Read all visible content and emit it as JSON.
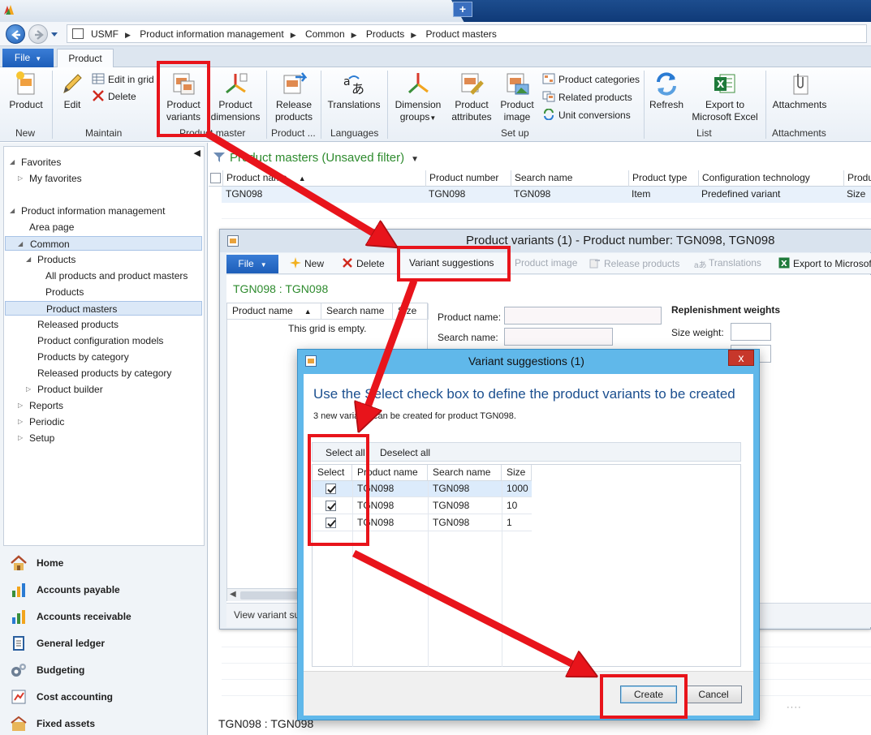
{
  "breadcrumb": [
    "USMF",
    "Product information management",
    "Common",
    "Products",
    "Product masters"
  ],
  "ribbon": {
    "file_tab": "File",
    "active_tab": "Product",
    "groups": {
      "new": "New",
      "maintain": "Maintain",
      "product_master": "Product master",
      "product_dots": "Product ...",
      "languages": "Languages",
      "set_up": "Set up",
      "list": "List",
      "attachments": "Attachments"
    },
    "buttons": {
      "product": "Product",
      "edit": "Edit",
      "edit_in_grid": "Edit in grid",
      "delete": "Delete",
      "product_variants_1": "Product",
      "product_variants_2": "variants",
      "product_dimensions_1": "Product",
      "product_dimensions_2": "dimensions",
      "release_products_1": "Release",
      "release_products_2": "products",
      "translations": "Translations",
      "dimension_groups_1": "Dimension",
      "dimension_groups_2": "groups",
      "product_attributes_1": "Product",
      "product_attributes_2": "attributes",
      "product_image_1": "Product",
      "product_image_2": "image",
      "product_categories": "Product categories",
      "related_products": "Related products",
      "unit_conversions": "Unit conversions",
      "refresh": "Refresh",
      "export_excel_1": "Export to",
      "export_excel_2": "Microsoft Excel",
      "attachments": "Attachments"
    }
  },
  "nav": {
    "favorites": "Favorites",
    "my_favorites": "My favorites",
    "module": "Product information management",
    "area_page": "Area page",
    "common": "Common",
    "products_folder": "Products",
    "all_products": "All products and product masters",
    "products": "Products",
    "product_masters": "Product masters",
    "released_products": "Released products",
    "product_config_models": "Product configuration models",
    "products_by_category": "Products by category",
    "released_by_category": "Released products by category",
    "product_builder": "Product builder",
    "reports": "Reports",
    "periodic": "Periodic",
    "setup": "Setup",
    "modules": [
      "Home",
      "Accounts payable",
      "Accounts receivable",
      "General ledger",
      "Budgeting",
      "Cost accounting",
      "Fixed assets"
    ]
  },
  "list_page": {
    "title": "Product masters (Unsaved filter)",
    "columns": [
      "Product name",
      "Product number",
      "Search name",
      "Product type",
      "Configuration technology",
      "Produ"
    ],
    "row": [
      "TGN098",
      "TGN098",
      "TGN098",
      "Item",
      "Predefined variant",
      "Size"
    ],
    "footer": "TGN098 : TGN098"
  },
  "pv_window": {
    "title": "Product variants (1) - Product number: TGN098, TGN098",
    "file": "File",
    "actions": {
      "new": "New",
      "delete": "Delete",
      "variant_suggestions": "Variant suggestions",
      "product_image": "Product image",
      "release_products": "Release products",
      "translations": "Translations",
      "export": "Export to Microsof"
    },
    "record": "TGN098 : TGN098",
    "grid_cols": [
      "Product name",
      "Search name",
      "Size"
    ],
    "grid_empty": "This grid is empty.",
    "product_name_label": "Product name:",
    "search_name_label": "Search name:",
    "replenishment": "Replenishment weights",
    "size_weight_label": "Size weight:",
    "status": "View variant su"
  },
  "vs_dialog": {
    "title": "Variant suggestions (1)",
    "close": "x",
    "heading": "Use the Select check box to define the product variants to be created",
    "subtext": "3 new variants can be created for product TGN098.",
    "select_all": "Select all",
    "deselect_all": "Deselect all",
    "columns": [
      "Select",
      "Product name",
      "Search name",
      "Size"
    ],
    "rows": [
      {
        "selected": true,
        "product_name": "TGN098",
        "search_name": "TGN098",
        "size": "1000"
      },
      {
        "selected": true,
        "product_name": "TGN098",
        "search_name": "TGN098",
        "size": "10"
      },
      {
        "selected": true,
        "product_name": "TGN098",
        "search_name": "TGN098",
        "size": "1"
      }
    ],
    "create": "Create",
    "cancel": "Cancel"
  },
  "colors": {
    "accent_blue": "#1d5eb9",
    "title_green": "#2e8b2e",
    "annotation_red": "#e8141b",
    "dialog_frame": "#60b8ea"
  }
}
